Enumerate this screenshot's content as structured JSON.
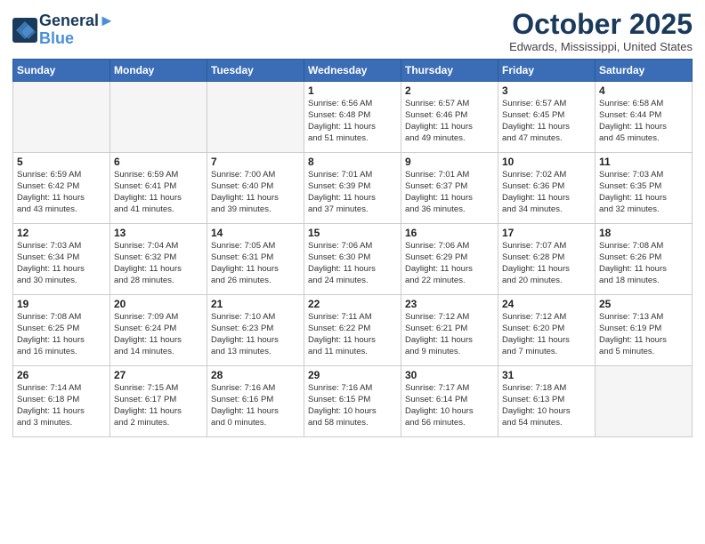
{
  "header": {
    "logo_line1": "General",
    "logo_line2": "Blue",
    "month": "October 2025",
    "location": "Edwards, Mississippi, United States"
  },
  "days_of_week": [
    "Sunday",
    "Monday",
    "Tuesday",
    "Wednesday",
    "Thursday",
    "Friday",
    "Saturday"
  ],
  "weeks": [
    [
      {
        "day": "",
        "info": ""
      },
      {
        "day": "",
        "info": ""
      },
      {
        "day": "",
        "info": ""
      },
      {
        "day": "1",
        "info": "Sunrise: 6:56 AM\nSunset: 6:48 PM\nDaylight: 11 hours\nand 51 minutes."
      },
      {
        "day": "2",
        "info": "Sunrise: 6:57 AM\nSunset: 6:46 PM\nDaylight: 11 hours\nand 49 minutes."
      },
      {
        "day": "3",
        "info": "Sunrise: 6:57 AM\nSunset: 6:45 PM\nDaylight: 11 hours\nand 47 minutes."
      },
      {
        "day": "4",
        "info": "Sunrise: 6:58 AM\nSunset: 6:44 PM\nDaylight: 11 hours\nand 45 minutes."
      }
    ],
    [
      {
        "day": "5",
        "info": "Sunrise: 6:59 AM\nSunset: 6:42 PM\nDaylight: 11 hours\nand 43 minutes."
      },
      {
        "day": "6",
        "info": "Sunrise: 6:59 AM\nSunset: 6:41 PM\nDaylight: 11 hours\nand 41 minutes."
      },
      {
        "day": "7",
        "info": "Sunrise: 7:00 AM\nSunset: 6:40 PM\nDaylight: 11 hours\nand 39 minutes."
      },
      {
        "day": "8",
        "info": "Sunrise: 7:01 AM\nSunset: 6:39 PM\nDaylight: 11 hours\nand 37 minutes."
      },
      {
        "day": "9",
        "info": "Sunrise: 7:01 AM\nSunset: 6:37 PM\nDaylight: 11 hours\nand 36 minutes."
      },
      {
        "day": "10",
        "info": "Sunrise: 7:02 AM\nSunset: 6:36 PM\nDaylight: 11 hours\nand 34 minutes."
      },
      {
        "day": "11",
        "info": "Sunrise: 7:03 AM\nSunset: 6:35 PM\nDaylight: 11 hours\nand 32 minutes."
      }
    ],
    [
      {
        "day": "12",
        "info": "Sunrise: 7:03 AM\nSunset: 6:34 PM\nDaylight: 11 hours\nand 30 minutes."
      },
      {
        "day": "13",
        "info": "Sunrise: 7:04 AM\nSunset: 6:32 PM\nDaylight: 11 hours\nand 28 minutes."
      },
      {
        "day": "14",
        "info": "Sunrise: 7:05 AM\nSunset: 6:31 PM\nDaylight: 11 hours\nand 26 minutes."
      },
      {
        "day": "15",
        "info": "Sunrise: 7:06 AM\nSunset: 6:30 PM\nDaylight: 11 hours\nand 24 minutes."
      },
      {
        "day": "16",
        "info": "Sunrise: 7:06 AM\nSunset: 6:29 PM\nDaylight: 11 hours\nand 22 minutes."
      },
      {
        "day": "17",
        "info": "Sunrise: 7:07 AM\nSunset: 6:28 PM\nDaylight: 11 hours\nand 20 minutes."
      },
      {
        "day": "18",
        "info": "Sunrise: 7:08 AM\nSunset: 6:26 PM\nDaylight: 11 hours\nand 18 minutes."
      }
    ],
    [
      {
        "day": "19",
        "info": "Sunrise: 7:08 AM\nSunset: 6:25 PM\nDaylight: 11 hours\nand 16 minutes."
      },
      {
        "day": "20",
        "info": "Sunrise: 7:09 AM\nSunset: 6:24 PM\nDaylight: 11 hours\nand 14 minutes."
      },
      {
        "day": "21",
        "info": "Sunrise: 7:10 AM\nSunset: 6:23 PM\nDaylight: 11 hours\nand 13 minutes."
      },
      {
        "day": "22",
        "info": "Sunrise: 7:11 AM\nSunset: 6:22 PM\nDaylight: 11 hours\nand 11 minutes."
      },
      {
        "day": "23",
        "info": "Sunrise: 7:12 AM\nSunset: 6:21 PM\nDaylight: 11 hours\nand 9 minutes."
      },
      {
        "day": "24",
        "info": "Sunrise: 7:12 AM\nSunset: 6:20 PM\nDaylight: 11 hours\nand 7 minutes."
      },
      {
        "day": "25",
        "info": "Sunrise: 7:13 AM\nSunset: 6:19 PM\nDaylight: 11 hours\nand 5 minutes."
      }
    ],
    [
      {
        "day": "26",
        "info": "Sunrise: 7:14 AM\nSunset: 6:18 PM\nDaylight: 11 hours\nand 3 minutes."
      },
      {
        "day": "27",
        "info": "Sunrise: 7:15 AM\nSunset: 6:17 PM\nDaylight: 11 hours\nand 2 minutes."
      },
      {
        "day": "28",
        "info": "Sunrise: 7:16 AM\nSunset: 6:16 PM\nDaylight: 11 hours\nand 0 minutes."
      },
      {
        "day": "29",
        "info": "Sunrise: 7:16 AM\nSunset: 6:15 PM\nDaylight: 10 hours\nand 58 minutes."
      },
      {
        "day": "30",
        "info": "Sunrise: 7:17 AM\nSunset: 6:14 PM\nDaylight: 10 hours\nand 56 minutes."
      },
      {
        "day": "31",
        "info": "Sunrise: 7:18 AM\nSunset: 6:13 PM\nDaylight: 10 hours\nand 54 minutes."
      },
      {
        "day": "",
        "info": ""
      }
    ]
  ]
}
